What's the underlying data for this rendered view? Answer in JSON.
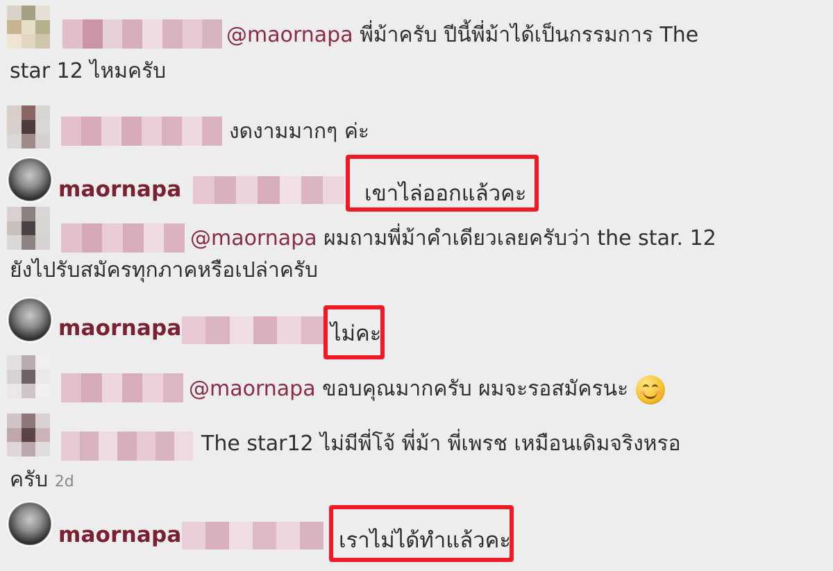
{
  "comments": [
    {
      "prefix": "",
      "mention": "@maornapa",
      "text_line_1": " พี่ม้าครับ ปีนี้พี่ม้าได้เป็นกรรมการ The",
      "text_line_2": "star 12 ไหมครับ",
      "time": ""
    },
    {
      "text": "งดงามมากๆ ค่ะ"
    },
    {
      "username": "maornapa",
      "reply": "เขาไล่ออกแล้วคะ"
    },
    {
      "mention": "@maornapa",
      "text_line_1": " ผมถามพี่ม้าคำเดียวเลยครับว่า the star. 12",
      "text_line_2": "ยังไปรับสมัครทุกภาคหรือเปล่าครับ"
    },
    {
      "username": "maornapa",
      "reply": "ไม่คะ"
    },
    {
      "mention": "@maornapa",
      "text_line_1": " ขอบคุณมากครับ ผมจะรอสมัครนะ"
    },
    {
      "text_line_1": "The star12 ไม่มีพี่โจ้ พี่ม้า พี่เพรช เหมือนเดิมจริงหรอ",
      "text_line_2": "ครับ",
      "time": "2d"
    },
    {
      "username": "maornapa",
      "reply": "เราไม่ได้ทำแล้วคะ"
    }
  ],
  "colors": {
    "background": "#ededed",
    "highlight": "#ef1a24",
    "username": "#7a2031",
    "mention": "#8c2c44",
    "body_text": "#2f2f2f",
    "time_text": "#888888"
  },
  "icons": {
    "avatar_generic": "avatar-icon",
    "emoji": "smile-emoji-icon"
  }
}
